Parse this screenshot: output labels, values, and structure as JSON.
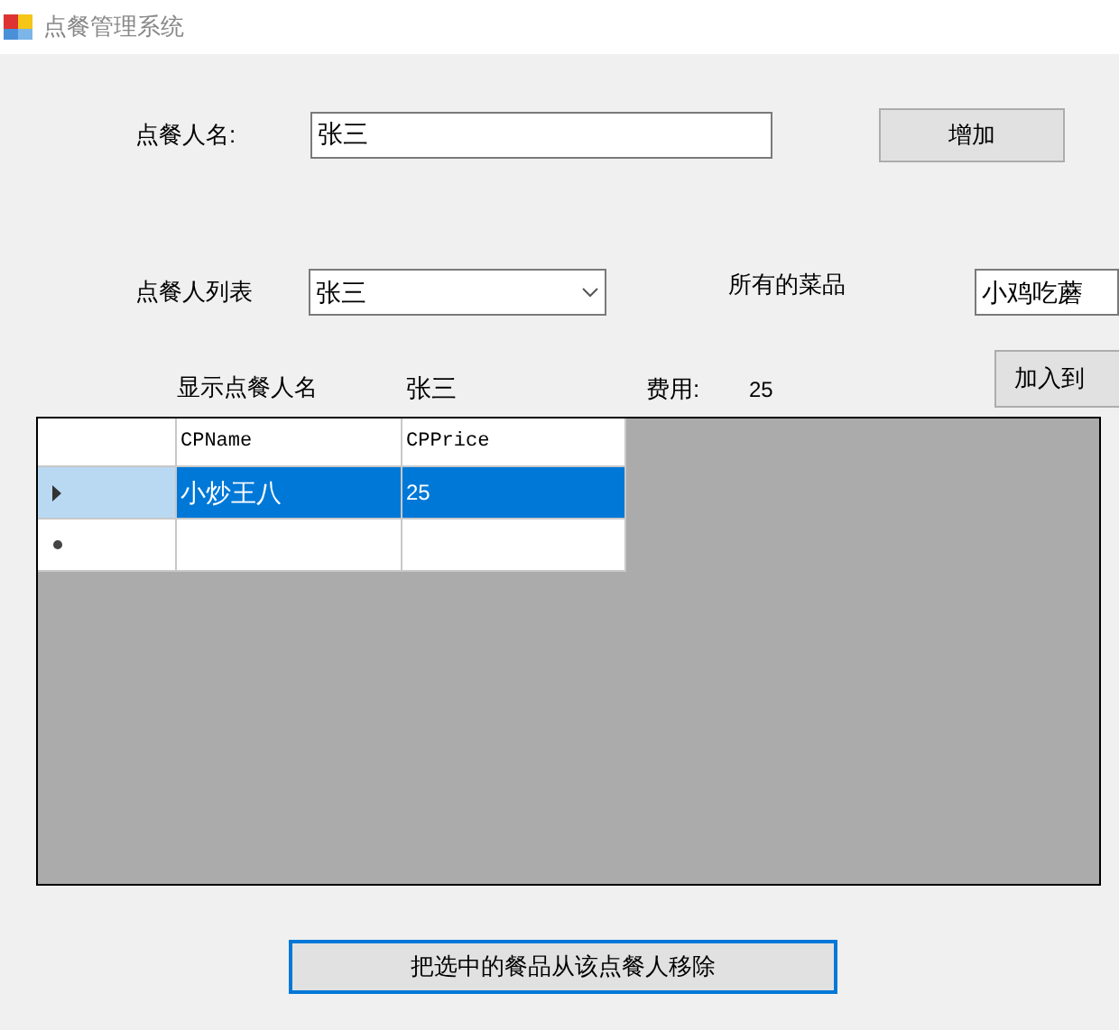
{
  "window": {
    "title": "点餐管理系统"
  },
  "name_label": "点餐人名:",
  "name_input": "张三",
  "add_button": "增加",
  "customer_list_label": "点餐人列表",
  "customer_combo": "张三",
  "dishes_label": "所有的菜品",
  "dishes_combo": "小鸡吃蘑",
  "show_name_label": "显示点餐人名",
  "show_name_value": "张三",
  "cost_label": "费用:",
  "cost_value": "25",
  "add_to_button": "加入到",
  "table": {
    "columns": [
      "CPName",
      "CPPrice"
    ],
    "rows": [
      {
        "kind": "data",
        "selected": true,
        "cells": [
          "小炒王八",
          "25"
        ]
      },
      {
        "kind": "new",
        "selected": false,
        "cells": [
          "",
          ""
        ]
      }
    ]
  },
  "remove_button": "把选中的餐品从该点餐人移除"
}
